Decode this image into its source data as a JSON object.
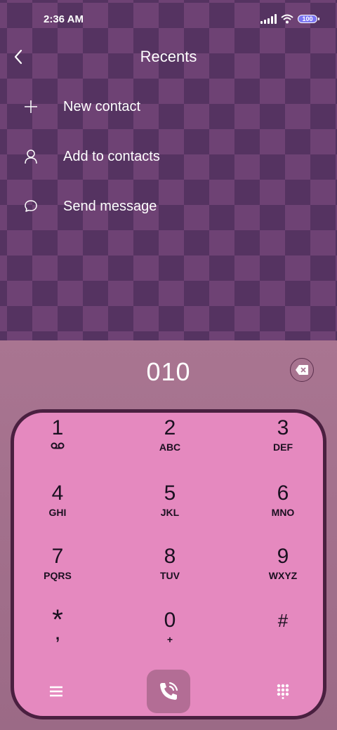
{
  "status_bar": {
    "time": "2:36 AM",
    "battery": "100"
  },
  "header": {
    "title": "Recents"
  },
  "menu": [
    {
      "label": "New contact",
      "icon": "plus-icon"
    },
    {
      "label": "Add to contacts",
      "icon": "person-icon"
    },
    {
      "label": "Send message",
      "icon": "chat-bubble-icon"
    }
  ],
  "dialer": {
    "number": "010",
    "keys": [
      {
        "digit": "1",
        "letters": ""
      },
      {
        "digit": "2",
        "letters": "ABC"
      },
      {
        "digit": "3",
        "letters": "DEF"
      },
      {
        "digit": "4",
        "letters": "GHI"
      },
      {
        "digit": "5",
        "letters": "JKL"
      },
      {
        "digit": "6",
        "letters": "MNO"
      },
      {
        "digit": "7",
        "letters": "PQRS"
      },
      {
        "digit": "8",
        "letters": "TUV"
      },
      {
        "digit": "9",
        "letters": "WXYZ"
      },
      {
        "digit": "*",
        "letters": ","
      },
      {
        "digit": "0",
        "letters": "+"
      },
      {
        "digit": "#",
        "letters": ""
      }
    ]
  },
  "colors": {
    "keypad": "#e589bf",
    "keypad_border": "#4a2040",
    "call_button": "#b36d95",
    "battery": "#7b75f2"
  }
}
